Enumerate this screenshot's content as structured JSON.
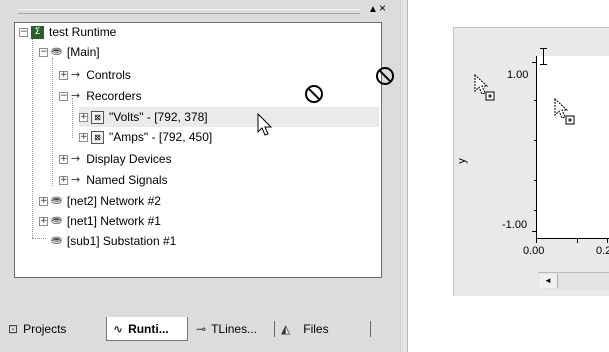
{
  "header": {
    "dropdown_glyph": "▲",
    "close_glyph": "×"
  },
  "tree": {
    "items": [
      {
        "label": "test Runtime",
        "expander": "−",
        "icon": "project-icon"
      },
      {
        "label": "[Main]",
        "expander": "−",
        "icon": "network-icon"
      },
      {
        "label": "Controls",
        "expander": "+",
        "icon": "arrow-icon"
      },
      {
        "label": "Recorders",
        "expander": "−",
        "icon": "arrow-icon"
      },
      {
        "label": "\"Volts\" - [792, 378]",
        "expander": "+",
        "icon": "recorder-icon"
      },
      {
        "label": "\"Amps\" - [792, 450]",
        "expander": "+",
        "icon": "recorder-icon"
      },
      {
        "label": "Display Devices",
        "expander": "+",
        "icon": "arrow-icon"
      },
      {
        "label": "Named Signals",
        "expander": "+",
        "icon": "arrow-icon"
      },
      {
        "label": "[net2] Network #2",
        "expander": "+",
        "icon": "network-icon"
      },
      {
        "label": "[net1] Network #1",
        "expander": "+",
        "icon": "network-icon"
      },
      {
        "label": "[sub1] Substation #1",
        "expander": "",
        "icon": "network-icon"
      }
    ]
  },
  "tabs": [
    {
      "label": "Projects",
      "icon": "projects-icon"
    },
    {
      "label": "Runti...",
      "icon": "runtime-icon",
      "active": true
    },
    {
      "label": "TLines...",
      "icon": "tlines-icon"
    },
    {
      "label": "Files",
      "icon": "files-icon"
    }
  ],
  "chart": {
    "y_label": "y",
    "y_ticks": [
      "1.00",
      "-1.00"
    ],
    "x_ticks": [
      "0.00",
      "0.2"
    ],
    "scroll_left_glyph": "◄"
  },
  "colors": {
    "pane_bg": "#dcdcdc",
    "tree_bg": "#ffffff",
    "selected_row": "#eaeaea",
    "chart_bg": "#e9e9e9"
  }
}
